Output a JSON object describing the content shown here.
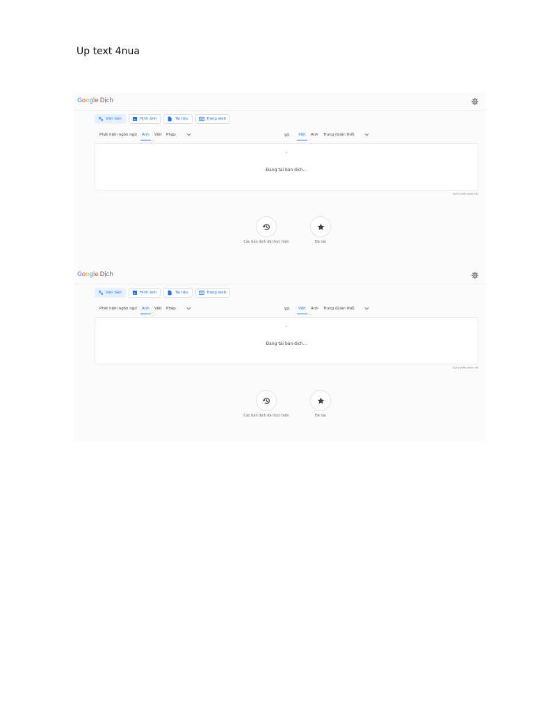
{
  "doc_heading": "Up text 4nua",
  "translate": {
    "logo": {
      "g1": "G",
      "o1": "o",
      "o2": "o",
      "g2": "g",
      "l": "l",
      "e": "e",
      "product": "Dịch"
    },
    "header_icons": {
      "settings": "gear-icon"
    },
    "modes": [
      {
        "label": "Văn bản",
        "icon": "translate-icon",
        "active": true
      },
      {
        "label": "Hình ảnh",
        "icon": "image-icon",
        "active": false
      },
      {
        "label": "Tài liệu",
        "icon": "document-icon",
        "active": false
      },
      {
        "label": "Trang web",
        "icon": "web-icon",
        "active": false
      }
    ],
    "source_langs": [
      "Phát hiện ngôn ngữ",
      "Anh",
      "Việt",
      "Pháp"
    ],
    "source_active": "Anh",
    "target_langs": [
      "Việt",
      "Anh",
      "Trung (Giản thể)"
    ],
    "target_active": "Việt",
    "loading_indicator": "-",
    "loading_text": "Đang tải bản dịch...",
    "feedback": "Gửi ý kiến phản hồi",
    "actions": [
      {
        "label": "Các bản dịch đã thực hiện",
        "icon": "history-icon"
      },
      {
        "label": "Đã lưu",
        "icon": "star-icon"
      }
    ]
  },
  "colors": {
    "accent": "#1a73e8",
    "active_mode_bg": "#e8f0fe",
    "text": "#3c4043",
    "muted": "#5f6368"
  }
}
